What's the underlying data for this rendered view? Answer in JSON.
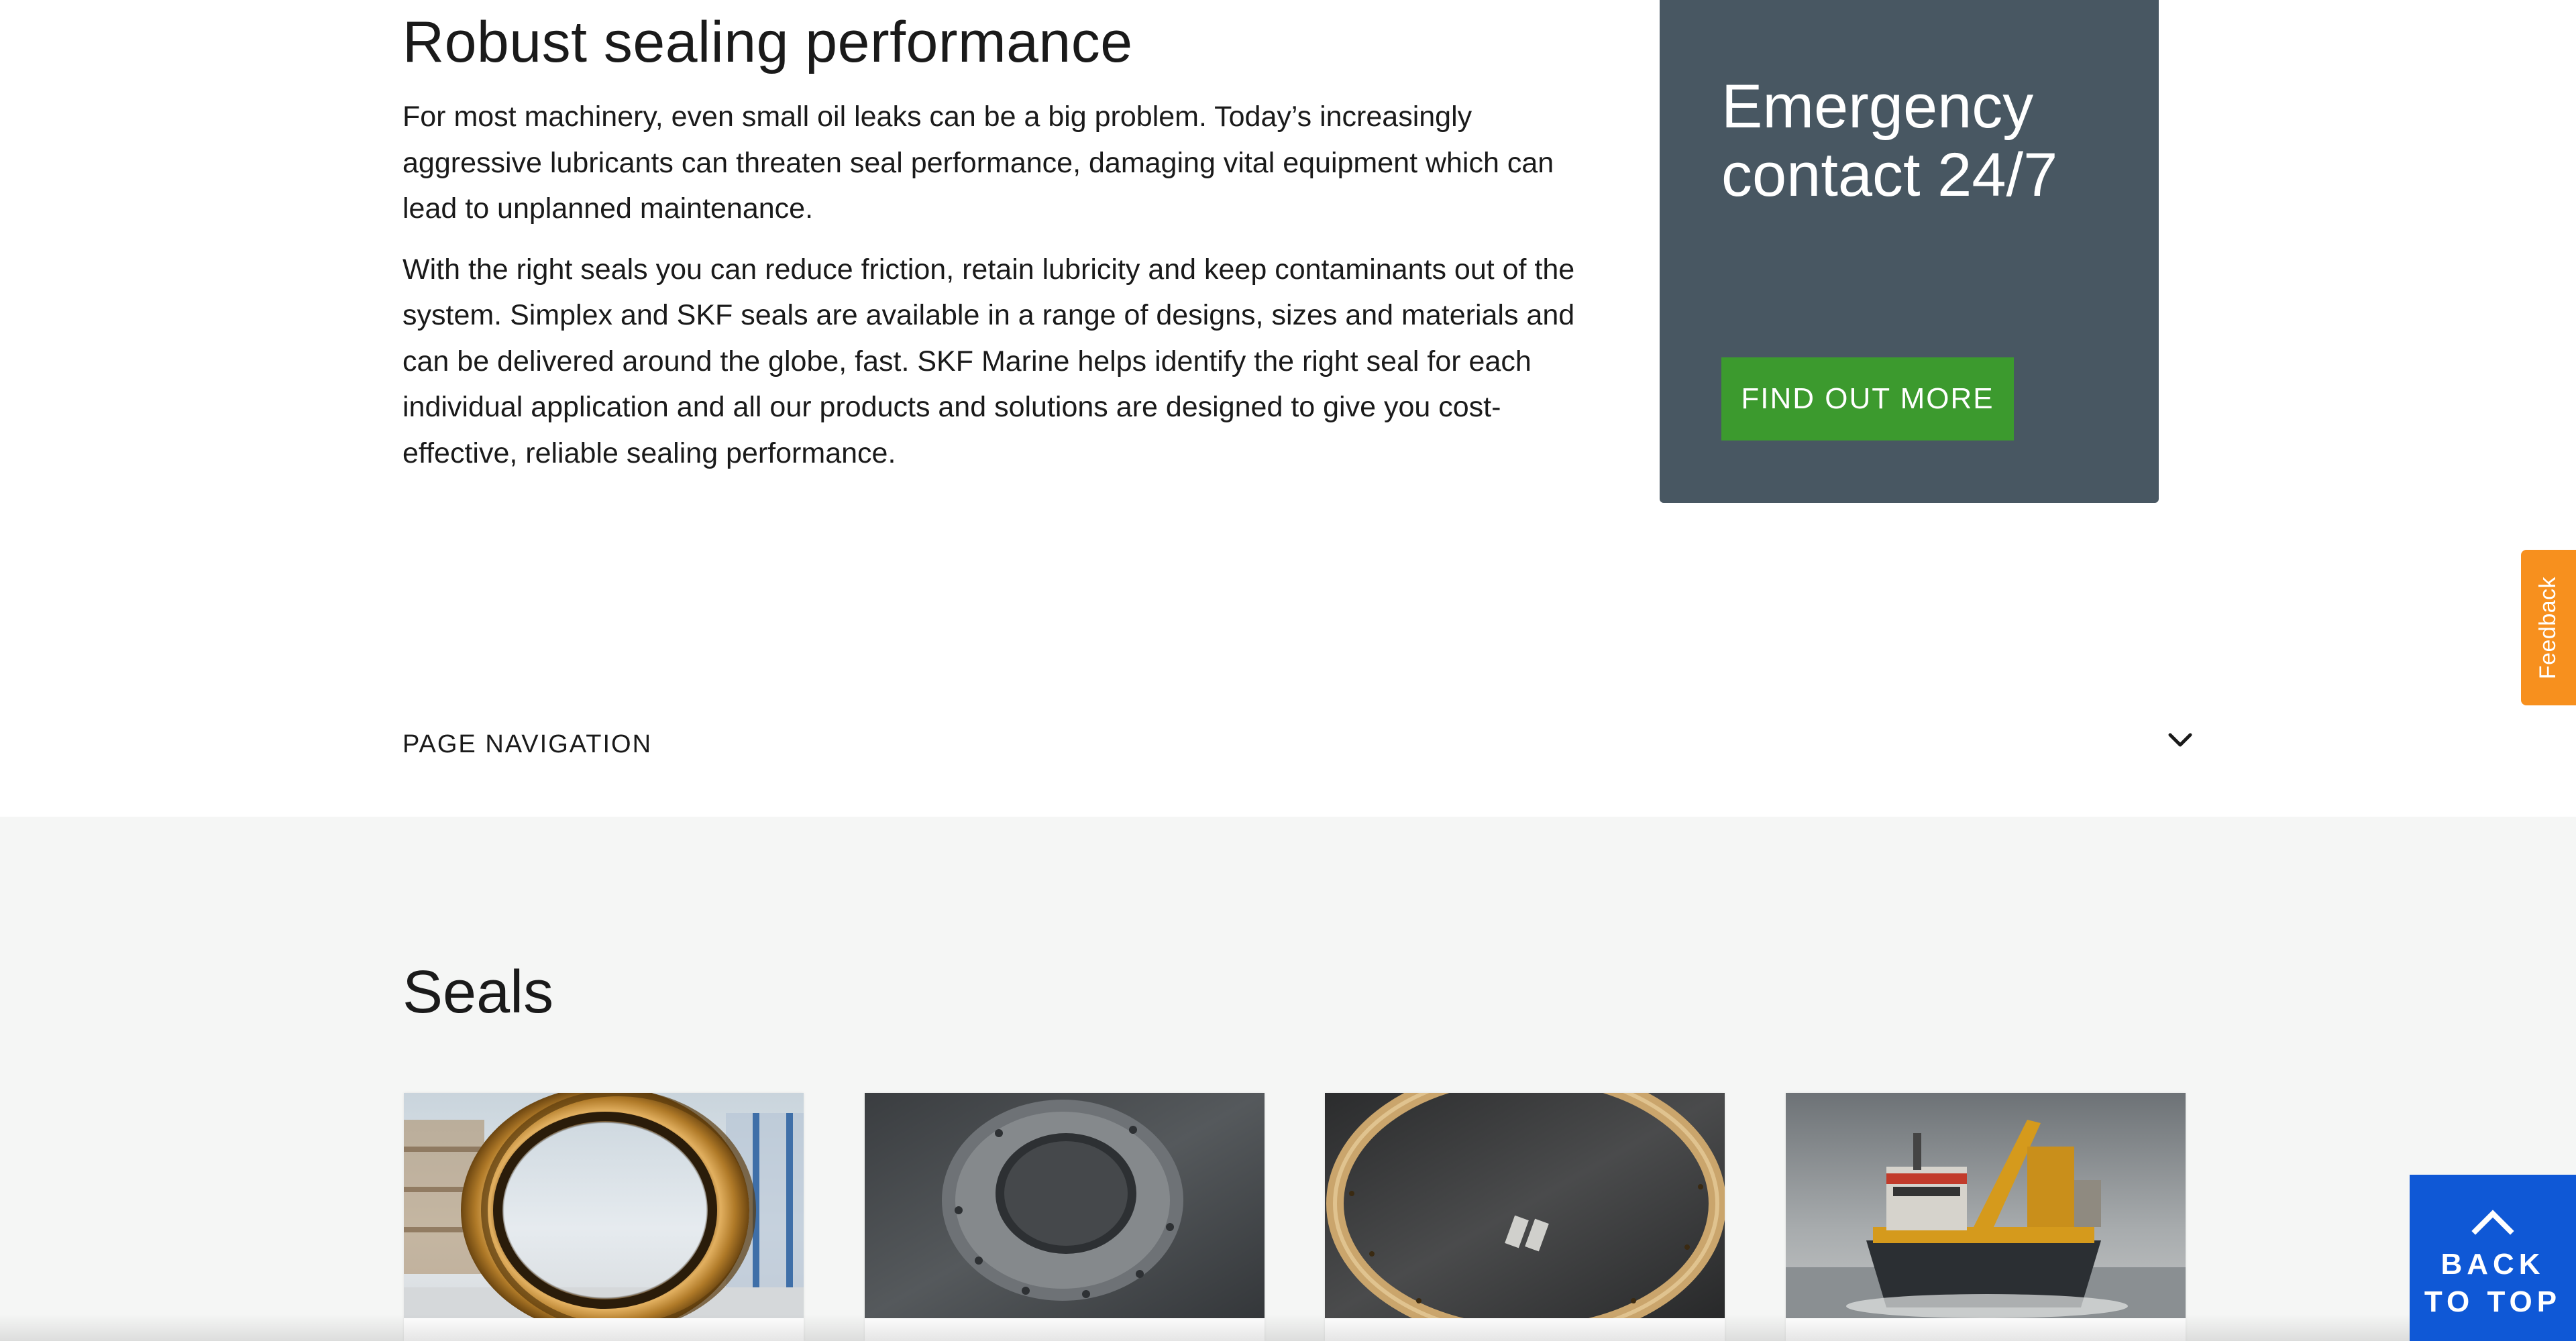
{
  "intro": {
    "heading": "Robust sealing performance",
    "paragraph_1": "For most machinery, even small oil leaks can be a big problem. Today’s increasingly aggressive lubricants can threaten seal performance, damaging vital equipment which can lead to unplanned maintenance.",
    "paragraph_2": "With the right seals you can reduce friction, retain lubricity and keep contaminants out of the system. Simplex and SKF seals are available in a range of designs, sizes and materials and can be delivered around the globe, fast. SKF Marine helps identify the right seal for each individual application and all our products and solutions are designed to give you cost-effective, reliable sealing performance."
  },
  "emergency": {
    "title": "Emergency contact 24/7",
    "button_label": "FIND OUT MORE"
  },
  "page_navigation": {
    "label": "PAGE NAVIGATION",
    "icon": "chevron-down-icon"
  },
  "seals": {
    "title": "Seals",
    "cards": [
      {
        "image": "brass-seal-ring-in-warehouse"
      },
      {
        "image": "grey-seal-flange-on-dark-surface"
      },
      {
        "image": "brass-split-ring-with-clips"
      },
      {
        "image": "dredging-ship-at-sea"
      }
    ]
  },
  "feedback": {
    "label": "Feedback"
  },
  "back_to_top": {
    "label": "BACK TO TOP",
    "icon": "chevron-up-icon"
  },
  "colors": {
    "emergency_card_bg": "#485762",
    "button_green": "#3c9a2e",
    "feedback_orange": "#f7901e",
    "back_to_top_blue": "#0f58d6",
    "seals_section_bg": "#f5f6f5"
  }
}
